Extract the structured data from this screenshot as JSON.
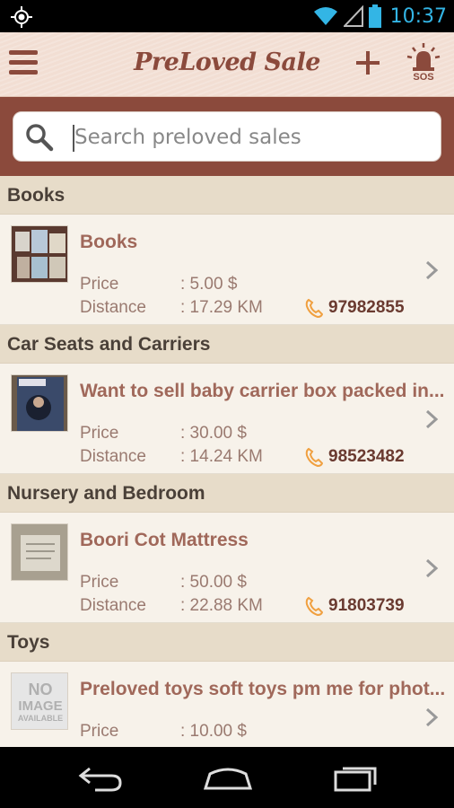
{
  "status_bar": {
    "time": "10:37"
  },
  "app": {
    "title": "PreLoved Sale",
    "sos_label": "SOS"
  },
  "search": {
    "placeholder": "Search preloved sales"
  },
  "labels": {
    "price": "Price",
    "distance": "Distance"
  },
  "sections": [
    {
      "title": "Books",
      "item": {
        "name": "Books",
        "price": ": 5.00 $",
        "distance": ": 17.29 KM",
        "phone": "97982855"
      }
    },
    {
      "title": "Car Seats and Carriers",
      "item": {
        "name": "Want to sell baby carrier box packed in...",
        "price": ": 30.00 $",
        "distance": ": 14.24 KM",
        "phone": "98523482"
      }
    },
    {
      "title": "Nursery and Bedroom",
      "item": {
        "name": "Boori Cot Mattress",
        "price": ": 50.00 $",
        "distance": ": 22.88 KM",
        "phone": "91803739"
      }
    },
    {
      "title": "Toys",
      "item": {
        "name": "Preloved toys soft toys pm me for phot...",
        "price": ": 10.00 $",
        "distance": "",
        "phone": ""
      }
    }
  ],
  "no_image": {
    "line1": "NO",
    "line2": "IMAGE",
    "line3": "AVAILABLE"
  },
  "colors": {
    "brown": "#8b4a3c",
    "accent_orange": "#f0a040",
    "status_blue": "#33b5e5"
  },
  "icons": [
    "gps-icon",
    "wifi-icon",
    "signal-icon",
    "battery-icon",
    "menu-icon",
    "add-icon",
    "sos-icon",
    "search-icon",
    "phone-icon",
    "chevron-right-icon",
    "back-icon",
    "home-icon",
    "recents-icon"
  ]
}
